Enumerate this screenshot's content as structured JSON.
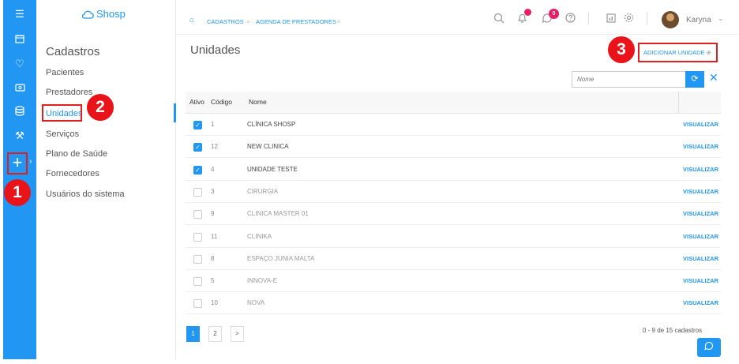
{
  "rail": {
    "icons": [
      "menu-icon",
      "calendar-icon",
      "heart-icon",
      "cash-icon",
      "database-icon",
      "tools-icon"
    ],
    "add_glyph": "+"
  },
  "annotations": {
    "one": "1",
    "two": "2",
    "three": "3"
  },
  "brand": {
    "name": "Shosp"
  },
  "sidebar": {
    "title": "Cadastros",
    "items": [
      {
        "label": "Pacientes"
      },
      {
        "label": "Prestadores"
      },
      {
        "label": "Unidades"
      },
      {
        "label": "Serviços"
      },
      {
        "label": "Plano de Saúde"
      },
      {
        "label": "Fornecedores"
      },
      {
        "label": "Usuários do sistema"
      }
    ]
  },
  "topbar": {
    "breadcrumbs": [
      "CADASTROS",
      "AGENDA DE PRESTADORES"
    ],
    "chat_badge": "0",
    "user_name": "Karyna"
  },
  "main": {
    "title": "Unidades",
    "add_button": "ADICIONAR UNIDADE",
    "filter_placeholder": "Nome",
    "columns": {
      "ativo": "Ativo",
      "codigo": "Código",
      "nome": "Nome"
    },
    "rows": [
      {
        "active": true,
        "code": "1",
        "name": "CLÍNICA SHOSP",
        "action": "VISUALIZAR"
      },
      {
        "active": true,
        "code": "12",
        "name": "NEW CLINICA",
        "action": "VISUALIZAR"
      },
      {
        "active": true,
        "code": "4",
        "name": "UNIDADE TESTE",
        "action": "VISUALIZAR"
      },
      {
        "active": false,
        "code": "3",
        "name": "CIRURGIA",
        "action": "VISUALIZAR"
      },
      {
        "active": false,
        "code": "9",
        "name": "CLINICA MASTER 01",
        "action": "VISUALIZAR"
      },
      {
        "active": false,
        "code": "11",
        "name": "CLINIKA",
        "action": "VISUALIZAR"
      },
      {
        "active": false,
        "code": "8",
        "name": "ESPAÇO JUNIA MALTA",
        "action": "VISUALIZAR"
      },
      {
        "active": false,
        "code": "5",
        "name": "INNOVA-E",
        "action": "VISUALIZAR"
      },
      {
        "active": false,
        "code": "10",
        "name": "NOVA",
        "action": "VISUALIZAR"
      }
    ],
    "pagination": {
      "pages": [
        "1",
        "2",
        ">"
      ],
      "current": "1"
    },
    "count_text": "0 - 9 de 15 cadastros"
  },
  "colors": {
    "accent": "#2196f3",
    "annotation": "#e8141a"
  }
}
